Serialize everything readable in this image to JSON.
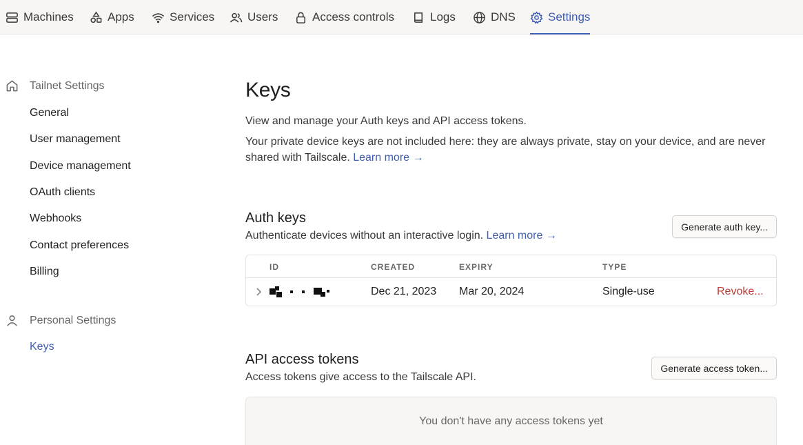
{
  "nav": {
    "items": [
      {
        "label": "Machines",
        "icon": "machines-icon"
      },
      {
        "label": "Apps",
        "icon": "apps-icon"
      },
      {
        "label": "Services",
        "icon": "wifi-icon"
      },
      {
        "label": "Users",
        "icon": "users-icon"
      },
      {
        "label": "Access controls",
        "icon": "lock-icon"
      },
      {
        "label": "Logs",
        "icon": "book-icon"
      },
      {
        "label": "DNS",
        "icon": "globe-icon"
      },
      {
        "label": "Settings",
        "icon": "gear-icon"
      }
    ],
    "active": "Settings",
    "accent": "#3e5db3"
  },
  "sidebar": {
    "tailnet_title": "Tailnet Settings",
    "tailnet_links": [
      "General",
      "User management",
      "Device management",
      "OAuth clients",
      "Webhooks",
      "Contact preferences",
      "Billing"
    ],
    "personal_title": "Personal Settings",
    "personal_links": [
      "Keys"
    ]
  },
  "page": {
    "title": "Keys",
    "intro1": "View and manage your Auth keys and API access tokens.",
    "intro2": "Your private device keys are not included here: they are always private, stay on your device, and are never shared with Tailscale.",
    "learn_more": "Learn more →"
  },
  "auth_keys": {
    "title": "Auth keys",
    "subtitle": "Authenticate devices without an interactive login.",
    "learn_more": "Learn more →",
    "button": "Generate auth key...",
    "columns": [
      "ID",
      "CREATED",
      "EXPIRY",
      "TYPE"
    ],
    "rows": [
      {
        "created": "Dec 21, 2023",
        "expiry": "Mar 20, 2024",
        "type": "Single-use",
        "action": "Revoke..."
      }
    ]
  },
  "api_tokens": {
    "title": "API access tokens",
    "subtitle": "Access tokens give access to the Tailscale API.",
    "button": "Generate access token...",
    "empty": "You don't have any access tokens yet"
  },
  "colors": {
    "danger": "#c13a33",
    "nav_bg": "#f7f6f5"
  }
}
